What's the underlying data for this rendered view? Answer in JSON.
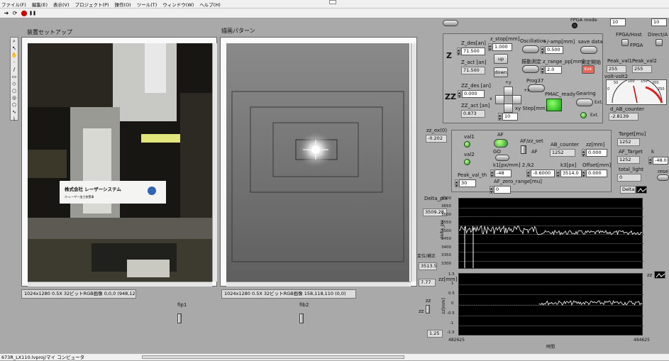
{
  "menu": [
    "ファイル(F)",
    "編集(E)",
    "表示(V)",
    "プロジェクト(P)",
    "操作(O)",
    "ツール(T)",
    "ウィンドウ(W)",
    "ヘルプ(H)"
  ],
  "toolbar": {
    "run": "➔",
    "run_cont": "⟳",
    "abort": "⬤",
    "pause": "❚❚"
  },
  "left_panel": {
    "title": "装置セットアップ",
    "sign_main": "株式会社 レーザーシステム",
    "sign_sub": "ホ-レーザー加工装置事",
    "caption": "1024x1280 0.5X 32ビットRGB画像 0,0,0 (948,1224)",
    "slider_label": "fip1"
  },
  "right_panel": {
    "title": "描画パターン",
    "caption": "1024x1280 0.5X 32ビットRGB画像 158,118,110 (0,0)",
    "slider_label": "fib2"
  },
  "top_right": {
    "fpga_mode_label": "FPGA mode",
    "top_val1": "10",
    "top_val2": "10",
    "fpga_host_label": "FPGA/Host",
    "fpga_label": "FPGA",
    "direct_label": "Direct/A",
    "peak_val1_label": "Peak_val1",
    "peak_val1": "255",
    "peak_val2_label": "Peak_val2",
    "peak_val2": "255",
    "volt_label": "volt-volt2",
    "gauge_ticks": [
      "0",
      "50",
      "100",
      "150",
      "200",
      "250"
    ],
    "d_ab_counter_label": "d_AB_counter",
    "d_ab_counter": "-2.8139"
  },
  "z_panel": {
    "z_label": "Z",
    "zz_label": "ZZ",
    "z_des_label": "Z_des[an]",
    "z_des": "71.500",
    "z_stop_label": "z_stop[mm]",
    "z_stop": "1.000",
    "up": "up",
    "down": "down",
    "z_act_label": "Z_act [an]",
    "z_act": "71.500",
    "oscillation_label": "Oscillation",
    "amp_label": "+/-amp[mm]",
    "amp": "0.500",
    "save_data_label": "save data",
    "repeat_label": "振動測定",
    "z_range_label": "z_range_pp[mm]",
    "z_range": "2.0",
    "measure_label": "測定開始",
    "measure_btn": "Exit",
    "zz_des_label": "ZZ_des [an]",
    "zz_des": "0.000",
    "zz_act_label": "ZZ_act [an]",
    "zz_act": "0.873",
    "prog_label": "Prog37",
    "pmac_label": "PMAC_ready",
    "gearing_label": "Gearing",
    "step_label": "xy Step[mm]",
    "step": "10",
    "ext1": "Ext.",
    "ext2": "Ext.",
    "x_plus": "+x",
    "x_minus": "x",
    "y_plus": "+y",
    "y_minus": "+y"
  },
  "af_panel": {
    "zz_ex_label": "zz_ex(0)",
    "zz_ex": "-0.202",
    "val1": "val1",
    "val2": "val2",
    "af_label": "AF",
    "go_label": "GO",
    "af_zz_label": "AF/zz_set",
    "af_toggle": "AF",
    "ab_counter_label": "AB_counter",
    "ab_counter": "1252",
    "zz_mm_label": "zz[mm]",
    "zz_mm": "0.000",
    "k1_label": "k1[px/mm] 2",
    "k1": "-48",
    "k2_label": "/k2",
    "k2": "-0.6000",
    "k3_label": "k3[px]",
    "k3": "3514.0",
    "offset_label": "Offset[mm]",
    "offset": "0.000",
    "peak_th_label": "Peak_val_th",
    "peak_th": "30",
    "af_zero_label": "AF_zero_range[mu]",
    "af_zero": "0",
    "target_mu_label": "Target[mu]",
    "target_mu": "1252",
    "af_target_label": "AF_Target",
    "af_target": "1252",
    "k_label": "k",
    "k_val": "-48.0",
    "total_light_label": "total_light",
    "total_light": "0",
    "delta_label": "Delta",
    "rese_label": "rese"
  },
  "chart_top": {
    "title": "Delta_pix",
    "ylabel": "delta_pix",
    "yticks": [
      "3700",
      "3650",
      "3600",
      "3550",
      "3500",
      "3450",
      "3400",
      "3350",
      "3300"
    ],
    "readout_top": "3509.28",
    "readout_side": "3513.50"
  },
  "chart_bottom": {
    "title": "zz[mm]",
    "ylabel": "zz[mm]",
    "yticks": [
      "1.5",
      "1",
      "0.5",
      "0",
      "-0.5",
      "-1",
      "-1.5"
    ],
    "readout_top": "7.77",
    "readout_bottom": "1.25",
    "xmin": "482625",
    "xmax": "484625",
    "xlabel": "時間",
    "side_label1": "変位/補正",
    "side_label2": "zz",
    "side_label3": "zz",
    "corner_label": "zz"
  },
  "statusbar": {
    "path": "673R_LX110.lvproj/マイ コンピュータ"
  },
  "colors": {
    "led_green": "#3ab82c",
    "chart_bg": "#000000",
    "panel_bg": "#a9a9a9"
  }
}
